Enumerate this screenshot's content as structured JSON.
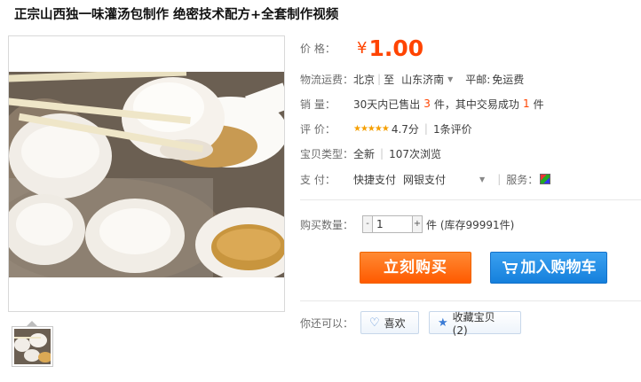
{
  "title": "正宗山西独一味灌汤包制作 绝密技术配方+全套制作视频",
  "price": {
    "label": "价 格：",
    "currency": "¥",
    "amount": "1.00"
  },
  "logistics": {
    "label": "物流运费：",
    "from": "北京",
    "to_prefix": "至",
    "to": "山东济南",
    "mail_label": "平邮:",
    "mail_value": "免运费"
  },
  "sales": {
    "label": "销 量：",
    "prefix": "30天内已售出",
    "count": "3",
    "unit": "件，其中交易成功",
    "success": "1",
    "suffix": "件"
  },
  "rating": {
    "label": "评 价：",
    "stars": "★★★★★",
    "score": "4.7分",
    "reviews": "1条评价"
  },
  "type": {
    "label": "宝贝类型：",
    "condition": "全新",
    "views": "107次浏览"
  },
  "payment": {
    "label": "支 付：",
    "methods": [
      "快捷支付",
      "网银支付"
    ],
    "service_label": "服务："
  },
  "quantity": {
    "label": "购买数量：",
    "minus": "-",
    "value": "1",
    "plus": "+",
    "stock": "件 (库存99991件)"
  },
  "buttons": {
    "buy": "立刻购买",
    "cart": "加入购物车"
  },
  "share": {
    "label": "你还可以：",
    "like": "喜欢",
    "favorite": "收藏宝贝 (2)"
  },
  "colors": {
    "price": "#ff4400",
    "buy_button": "#ff6a00",
    "cart_button": "#2a8ee8"
  },
  "icons": [
    "cart-icon",
    "heart-icon",
    "star-icon",
    "service-icon",
    "chevron-down-icon"
  ]
}
